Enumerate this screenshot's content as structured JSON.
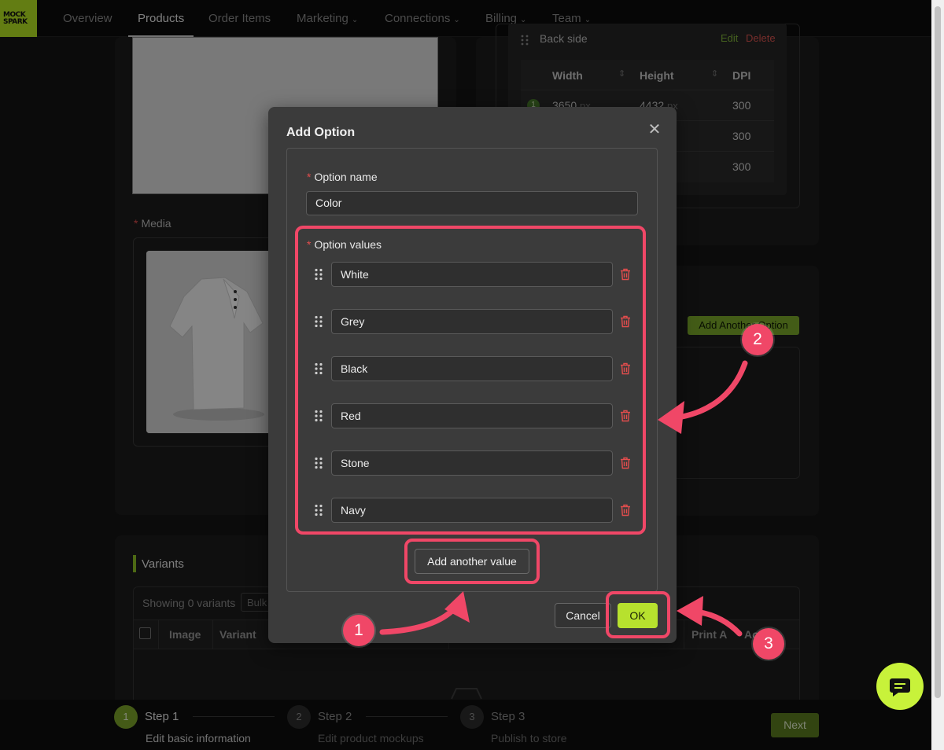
{
  "nav": {
    "logo_text": "MOCK SPARK",
    "items": [
      {
        "label": "Overview"
      },
      {
        "label": "Products"
      },
      {
        "label": "Order Items"
      },
      {
        "label": "Marketing"
      },
      {
        "label": "Connections"
      },
      {
        "label": "Billing"
      },
      {
        "label": "Team"
      }
    ],
    "active": "Products"
  },
  "media": {
    "label": "Media"
  },
  "backside": {
    "label": "Back side",
    "edit": "Edit",
    "delete": "Delete",
    "columns": [
      "Width",
      "Height",
      "DPI"
    ],
    "row_number": "1",
    "rows": [
      {
        "width": "3650",
        "height": "4432",
        "unit": "px",
        "dpi": "300"
      },
      {
        "width": "",
        "height": "",
        "unit": "",
        "dpi": "300"
      },
      {
        "width": "",
        "height": "",
        "unit": "",
        "dpi": "300"
      }
    ]
  },
  "options": {
    "add_another_option": "Add Another Option"
  },
  "variants": {
    "title": "Variants",
    "showing": "Showing 0 variants",
    "bulk": "Bulk",
    "columns": {
      "image": "Image",
      "variant": "Variant",
      "print": "Print A",
      "actions": "Ac"
    }
  },
  "steps": [
    {
      "num": "1",
      "title": "Step 1",
      "sub": "Edit basic information"
    },
    {
      "num": "2",
      "title": "Step 2",
      "sub": "Edit product mockups"
    },
    {
      "num": "3",
      "title": "Step 3",
      "sub": "Publish to store"
    }
  ],
  "next_label": "Next",
  "modal": {
    "title": "Add Option",
    "option_name_label": "Option name",
    "option_name_value": "Color",
    "option_values_label": "Option values",
    "values": [
      "White",
      "Grey",
      "Black",
      "Red",
      "Stone",
      "Navy"
    ],
    "add_value_label": "Add another value",
    "cancel_label": "Cancel",
    "ok_label": "OK"
  },
  "annotations": {
    "badge_1": "1",
    "badge_2": "2",
    "badge_3": "3"
  },
  "colors": {
    "accent": "#b7e12e",
    "highlight": "#f04767",
    "danger": "#e34d4d"
  }
}
